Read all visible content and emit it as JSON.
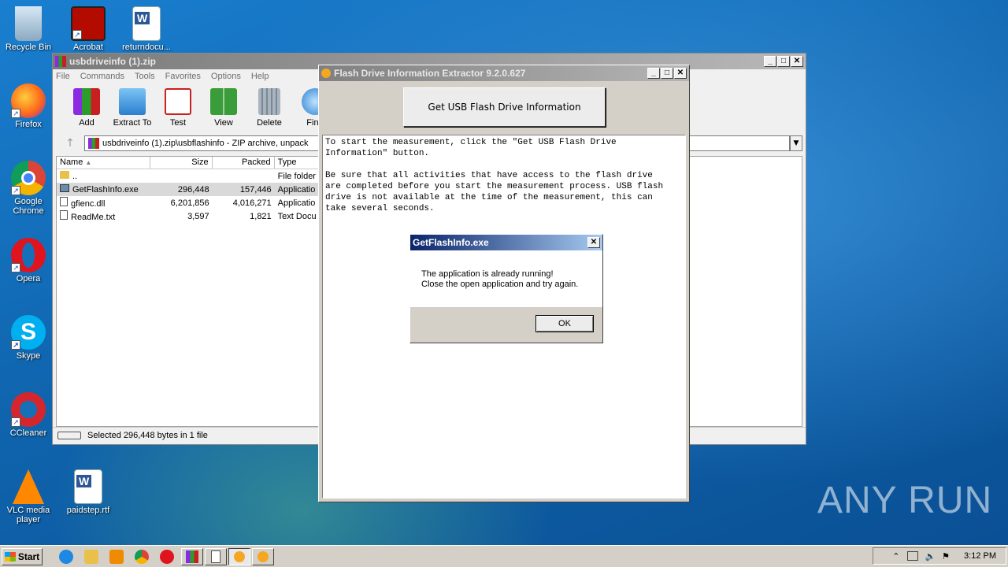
{
  "desktop": {
    "icons": [
      {
        "label": "Recycle Bin"
      },
      {
        "label": "Acrobat"
      },
      {
        "label": "returndocu..."
      },
      {
        "label": "Firefox"
      },
      {
        "label": "Google Chrome"
      },
      {
        "label": "Opera"
      },
      {
        "label": "Skype"
      },
      {
        "label": "CCleaner"
      },
      {
        "label": "VLC media player"
      },
      {
        "label": "paidstep.rtf"
      }
    ],
    "watermark": "ANY RUN"
  },
  "winrar": {
    "title": "usbdriveinfo (1).zip",
    "menu": [
      "File",
      "Commands",
      "Tools",
      "Favorites",
      "Options",
      "Help"
    ],
    "toolbar": [
      "Add",
      "Extract To",
      "Test",
      "View",
      "Delete",
      "Find"
    ],
    "address": "usbdriveinfo (1).zip\\usbflashinfo - ZIP archive, unpack",
    "columns": [
      "Name",
      "Size",
      "Packed",
      "Type"
    ],
    "rows": [
      {
        "name": "..",
        "size": "",
        "packed": "",
        "type": "File folder"
      },
      {
        "name": "GetFlashInfo.exe",
        "size": "296,448",
        "packed": "157,446",
        "type": "Applicatio"
      },
      {
        "name": "gfienc.dll",
        "size": "6,201,856",
        "packed": "4,016,271",
        "type": "Applicatio"
      },
      {
        "name": "ReadMe.txt",
        "size": "3,597",
        "packed": "1,821",
        "type": "Text Docu"
      }
    ],
    "status": "Selected 296,448 bytes in 1 file"
  },
  "flashdrive": {
    "title": "Flash Drive Information Extractor 9.2.0.627",
    "button": "Get USB Flash Drive Information",
    "text": "To start the measurement, click the \"Get USB Flash Drive\nInformation\" button.\n\nBe sure that all activities that have access to the flash drive\nare completed before you start the measurement process. USB flash\ndrive is not available at the time of the measurement, this can\ntake several seconds."
  },
  "dialog": {
    "title": "GetFlashInfo.exe",
    "line1": "The application is already running!",
    "line2": "Close the open application and try again.",
    "ok": "OK"
  },
  "taskbar": {
    "start": "Start",
    "clock": "3:12 PM"
  }
}
